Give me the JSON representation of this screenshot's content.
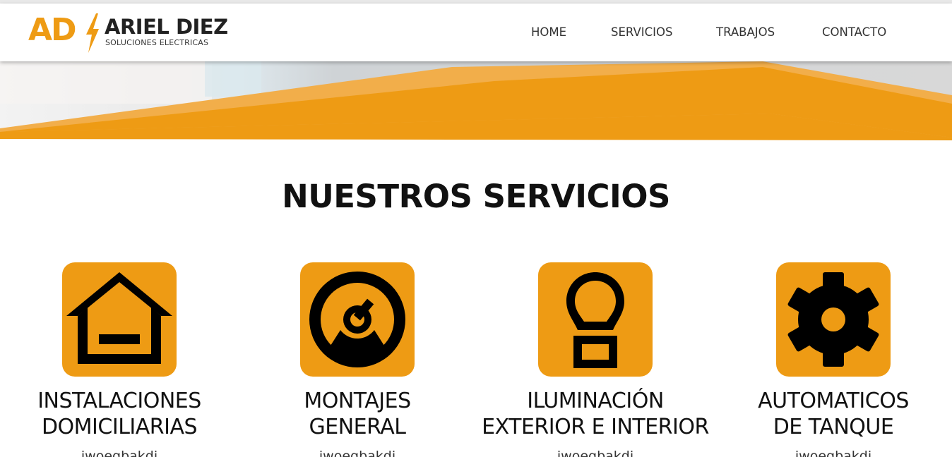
{
  "brand": {
    "mark": "AD",
    "name": "ARIEL DIEZ",
    "tagline": "SOLUCIONES ELECTRICAS",
    "accent_color": "#ee9b14"
  },
  "nav": {
    "items": [
      {
        "label": "HOME"
      },
      {
        "label": "SERVICIOS"
      },
      {
        "label": "TRABAJOS"
      },
      {
        "label": "CONTACTO"
      }
    ]
  },
  "services": {
    "title": "NUESTROS SERVICIOS",
    "items": [
      {
        "icon": "house-icon",
        "line1": "INSTALACIONES",
        "line2": "DOMICILIARIAS",
        "desc": "jwoegbakdj"
      },
      {
        "icon": "gauge-icon",
        "line1": "MONTAJES",
        "line2": "GENERAL",
        "desc": "jwoegbakdj"
      },
      {
        "icon": "lightbulb-icon",
        "line1": "ILUMINACIÓN",
        "line2": "EXTERIOR E INTERIOR",
        "desc": "jwoegbakdj"
      },
      {
        "icon": "gear-icon",
        "line1": "AUTOMATICOS",
        "line2": "DE TANQUE",
        "desc": "jwoegbakdj"
      }
    ]
  }
}
